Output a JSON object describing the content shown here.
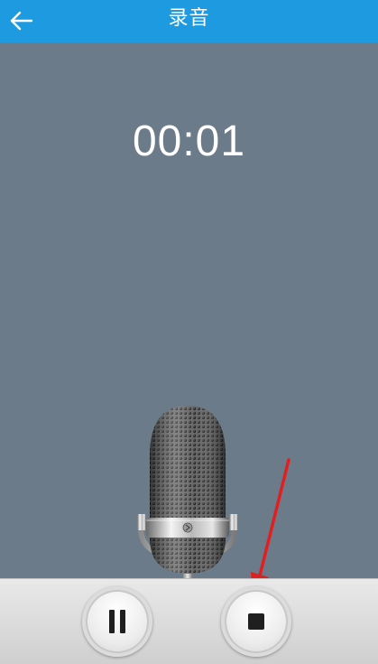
{
  "header": {
    "title": "录音",
    "background_color": "#1e9be0"
  },
  "recorder": {
    "elapsed_time": "00:01",
    "background_color": "#6b7b8a"
  },
  "controls": {
    "pause_icon": "pause-icon",
    "stop_icon": "stop-icon"
  },
  "annotation": {
    "color": "#e02020",
    "points_to": "stop-button"
  }
}
